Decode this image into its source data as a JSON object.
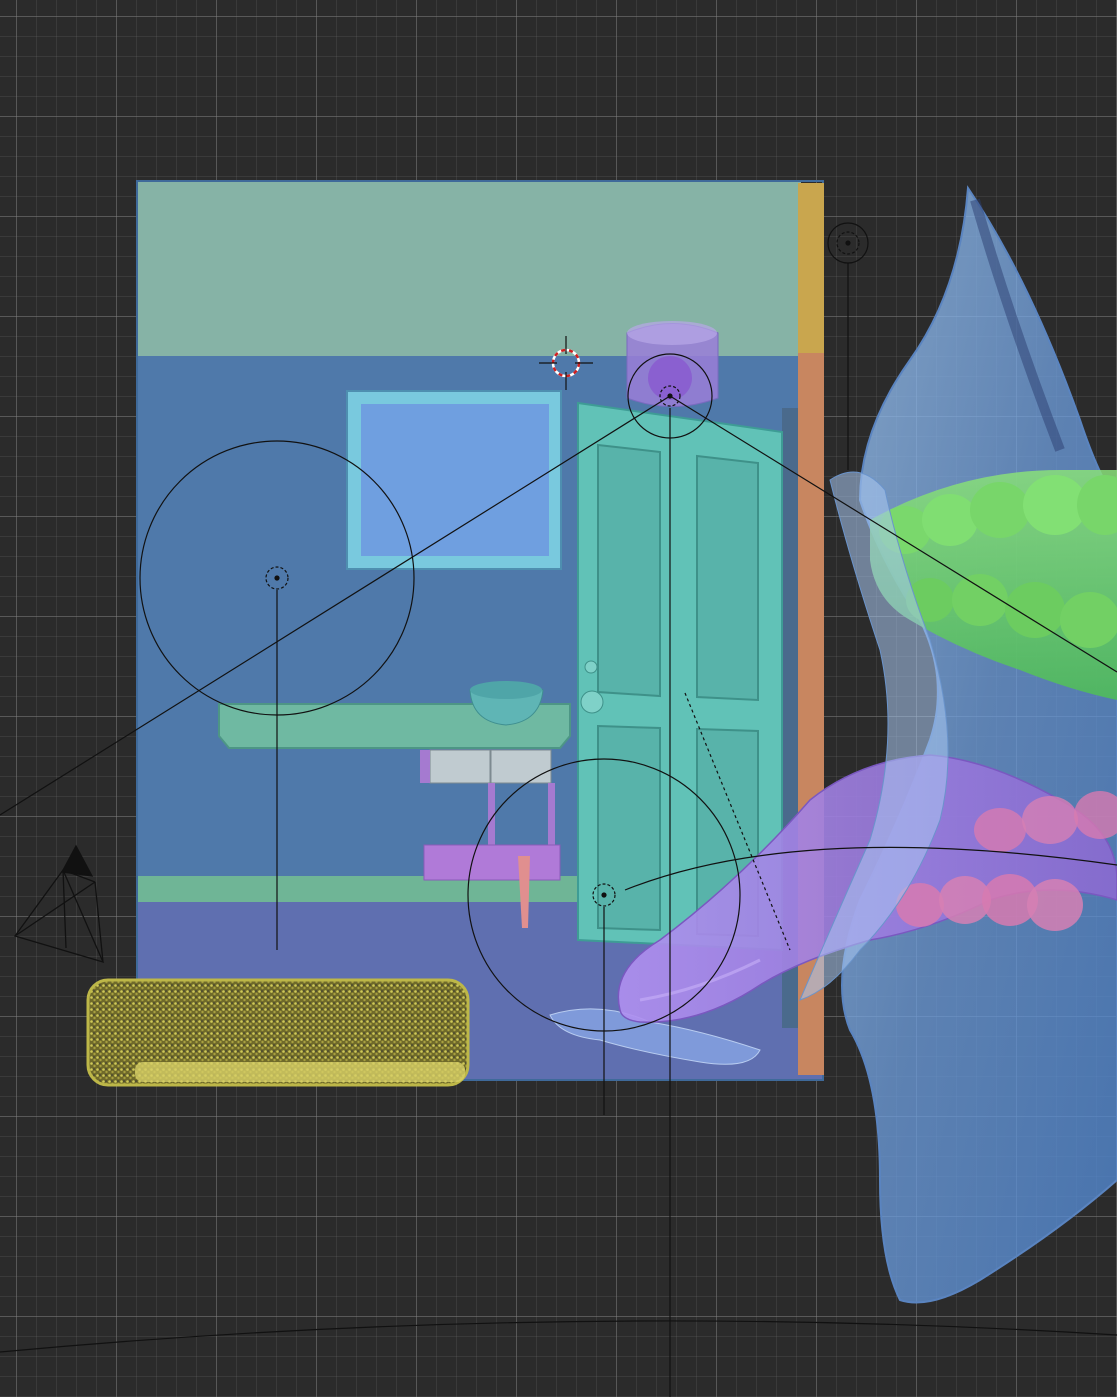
{
  "viewport": {
    "name": "3d-viewport",
    "background": "#2b2b2b",
    "grid_color": "#4a4a4a"
  },
  "scene": {
    "objects": [
      {
        "name": "room-back-wall-upper",
        "color": "#86b3a6"
      },
      {
        "name": "room-back-wall-lower",
        "color": "#4f79aa"
      },
      {
        "name": "room-floor",
        "color": "#5f6fb0"
      },
      {
        "name": "mirror",
        "color": "#6f9fe0"
      },
      {
        "name": "door",
        "color": "#61c2b7"
      },
      {
        "name": "vanity-counter",
        "color": "#6fb9a2"
      },
      {
        "name": "sink-bowl",
        "color": "#5fb5b5"
      },
      {
        "name": "rug",
        "color": "#cfc95a"
      },
      {
        "name": "tongue",
        "color": "#a080d8"
      },
      {
        "name": "teeth-upper",
        "color": "#6ad06a"
      },
      {
        "name": "teeth-lower",
        "color": "#d77ab0"
      },
      {
        "name": "lip-shell",
        "color": "#7aa8e6"
      },
      {
        "name": "ceiling-light-shade",
        "color": "#9a7ed8"
      },
      {
        "name": "wall-trim-right",
        "color": "#d08858"
      }
    ]
  }
}
